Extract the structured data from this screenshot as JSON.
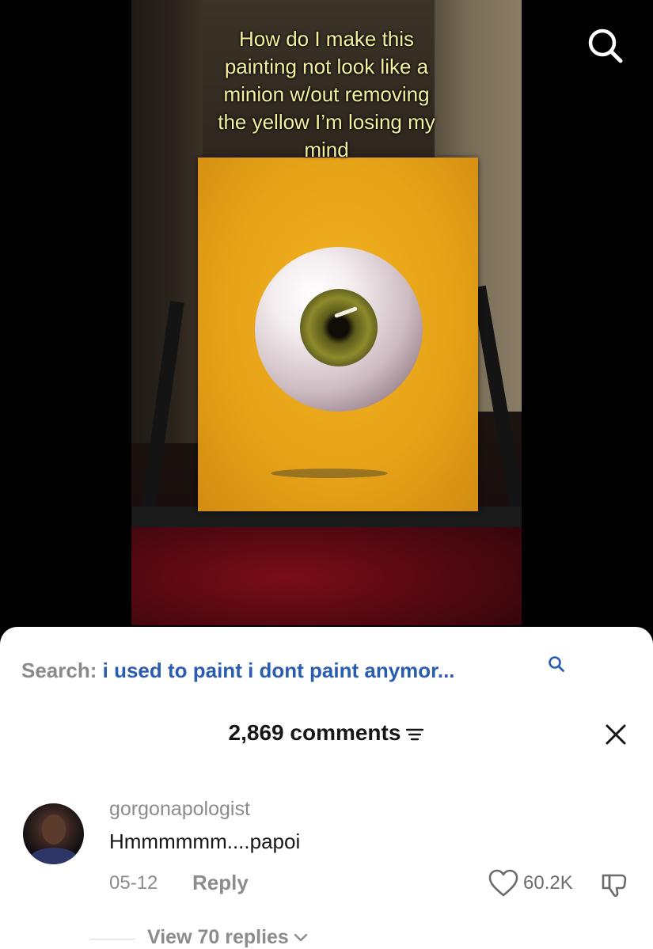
{
  "video": {
    "caption_lines": [
      "How do I make this",
      "painting not look like a",
      "minion w/out removing",
      "the yellow I’m losing my",
      "mind"
    ],
    "top_search_icon": "search-icon"
  },
  "sheet": {
    "search": {
      "prefix": "Search:",
      "query": "i used to paint i dont paint anymor...",
      "icon": "search-icon"
    },
    "header": {
      "comments_count": "2,869 comments",
      "filter_icon": "filter-icon",
      "close_icon": "close-icon"
    },
    "comment": {
      "username": "gorgonapologist",
      "text": "Hmmmmmm....papoi",
      "date": "05-12",
      "reply_label": "Reply",
      "like_count": "60.2K",
      "like_icon": "heart-icon",
      "dislike_icon": "thumbs-down-icon",
      "view_replies": "View 70 replies"
    }
  },
  "colors": {
    "link_blue": "#2a5cb0",
    "muted_gray": "#8c8c8c",
    "caption_yellow": "#f5ef9e"
  }
}
